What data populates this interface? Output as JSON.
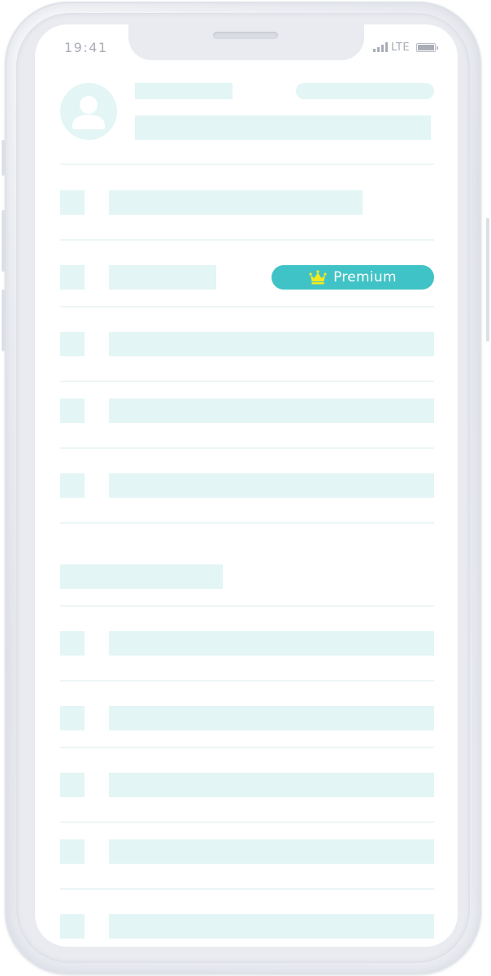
{
  "status_bar": {
    "time": "19:41",
    "network": "LTE"
  },
  "premium_badge": {
    "label": "Premium",
    "icon": "crown-icon",
    "background": "#40c3c6",
    "crown_color": "#f5ea1b"
  },
  "colors": {
    "placeholder": "#e3f5f5",
    "divider": "#ecf6f6",
    "avatar_glyph": "#ffffff"
  }
}
